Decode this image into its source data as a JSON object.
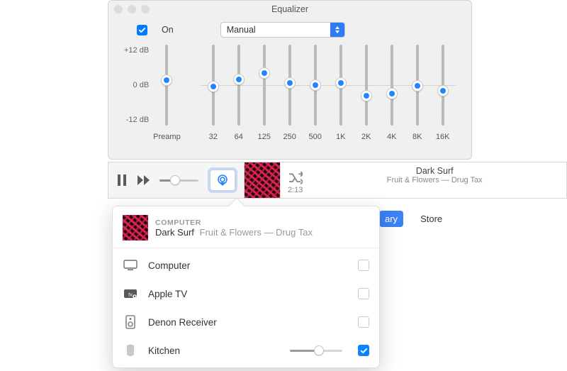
{
  "equalizer": {
    "title": "Equalizer",
    "on_label": "On",
    "on_checked": true,
    "preset": "Manual",
    "db_top": "+12 dB",
    "db_mid": "0 dB",
    "db_bot": "-12 dB",
    "preamp_label": "Preamp",
    "preamp_value": 1.5,
    "bands": [
      {
        "freq": "32",
        "value": -0.5
      },
      {
        "freq": "64",
        "value": 1.7
      },
      {
        "freq": "125",
        "value": 3.5
      },
      {
        "freq": "250",
        "value": 0.7
      },
      {
        "freq": "500",
        "value": 0
      },
      {
        "freq": "1K",
        "value": 0.6
      },
      {
        "freq": "2K",
        "value": -3.2
      },
      {
        "freq": "4K",
        "value": -2.5
      },
      {
        "freq": "8K",
        "value": -0.3
      },
      {
        "freq": "16K",
        "value": -1.7
      }
    ]
  },
  "player": {
    "volume_pct": 30,
    "now_playing": {
      "title": "Dark Surf",
      "meta": "Fruit & Flowers — Drug Tax",
      "elapsed": "2:13"
    }
  },
  "tabs": {
    "library": "ary",
    "store": "Store"
  },
  "popover": {
    "location": "COMPUTER",
    "title": "Dark Surf",
    "meta": "Fruit & Flowers — Drug Tax",
    "devices": [
      {
        "icon": "monitor",
        "name": "Computer",
        "checked": false,
        "has_volume": false
      },
      {
        "icon": "appletv",
        "name": "Apple TV",
        "checked": false,
        "has_volume": false
      },
      {
        "icon": "speaker",
        "name": "Denon Receiver",
        "checked": false,
        "has_volume": false
      },
      {
        "icon": "homepod",
        "name": "Kitchen",
        "checked": true,
        "has_volume": true,
        "volume_pct": 55
      }
    ]
  }
}
